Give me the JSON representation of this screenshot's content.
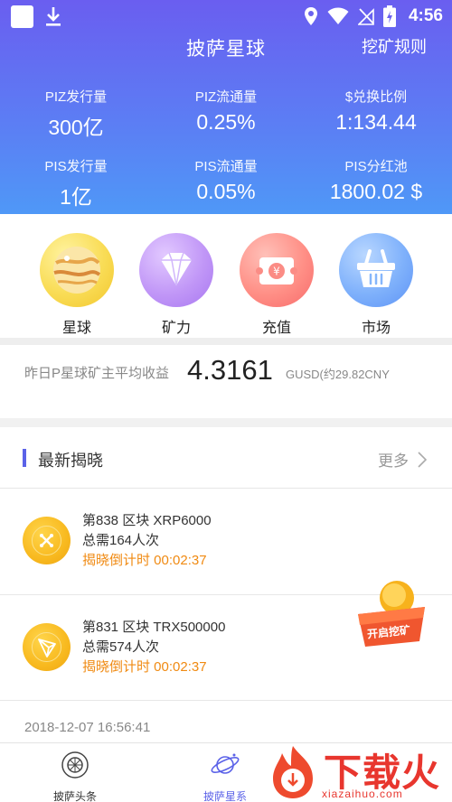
{
  "status_bar": {
    "time": "4:56"
  },
  "header": {
    "title": "披萨星球",
    "rules_link": "挖矿规则",
    "stats": [
      {
        "label": "PIZ发行量",
        "value": "300亿"
      },
      {
        "label": "PIZ流通量",
        "value": "0.25%"
      },
      {
        "label": "$兑换比例",
        "value": "1:134.44"
      },
      {
        "label": "PIS发行量",
        "value": "1亿"
      },
      {
        "label": "PIS流通量",
        "value": "0.05%"
      },
      {
        "label": "PIS分红池",
        "value": "1800.02 $"
      }
    ]
  },
  "shortcuts": [
    {
      "label": "星球",
      "icon": "planet-icon"
    },
    {
      "label": "矿力",
      "icon": "diamond-icon"
    },
    {
      "label": "充值",
      "icon": "recharge-ticket-icon"
    },
    {
      "label": "市场",
      "icon": "basket-icon"
    }
  ],
  "earnings": {
    "label": "昨日P星球矿主平均收益",
    "value": "4.3161",
    "unit": "GUSD(约29.82CNY"
  },
  "latest": {
    "title": "最新揭晓",
    "more": "更多",
    "items": [
      {
        "block": "第838 区块  XRP6000",
        "need": "总需164人次",
        "countdown": "揭晓倒计时 00:02:37",
        "icon": "xrp-coin-icon"
      },
      {
        "block": "第831 区块  TRX500000",
        "need": "总需574人次",
        "countdown": "揭晓倒计时 00:02:37",
        "icon": "trx-coin-icon"
      }
    ],
    "footer_date": "2018-12-07 16:56:41"
  },
  "floating_button": {
    "label": "开启挖矿"
  },
  "tabbar": {
    "tabs": [
      {
        "label": "披萨头条",
        "active": false
      },
      {
        "label": "披萨星系",
        "active": true
      }
    ]
  },
  "watermark": {
    "text": "下载火",
    "url": "xiazaihuo.com"
  },
  "colors": {
    "accent": "#5b62e8",
    "countdown": "#f08a12",
    "brand_red": "#e8362e"
  }
}
